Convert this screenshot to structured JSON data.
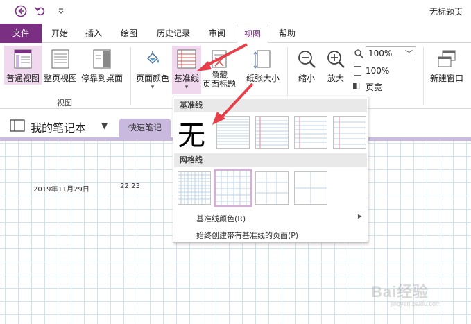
{
  "window": {
    "title": "无标题页"
  },
  "tabs": [
    {
      "label": "文件"
    },
    {
      "label": "开始"
    },
    {
      "label": "插入"
    },
    {
      "label": "绘图"
    },
    {
      "label": "历史记录"
    },
    {
      "label": "审阅"
    },
    {
      "label": "视图"
    },
    {
      "label": "帮助"
    }
  ],
  "ribbon": {
    "views_group": {
      "normal_view": "普通视图",
      "full_page_view": "整页视图",
      "dock_to_desktop": "停靠到桌面",
      "group_label": "视图"
    },
    "page_setup": {
      "page_color": "页面颜色",
      "rule_lines": "基准线",
      "hide_title": "隐藏\n页面标题",
      "paper_size": "纸张大小"
    },
    "zoom": {
      "zoom_out": "缩小",
      "zoom_in": "放大",
      "zoom_value": "100%",
      "percent_100": "100%",
      "page_width": "页宽"
    },
    "window": {
      "new_window": "新建窗口"
    }
  },
  "notebook": {
    "name": "我的笔记本",
    "section": "快速笔记"
  },
  "page": {
    "date": "2019年11月29日",
    "time": "22:23"
  },
  "dropdown": {
    "rule_lines_header": "基准线",
    "none_label": "无",
    "grid_lines_header": "网格线",
    "rule_line_color": "基准线颜色(R)",
    "always_create": "始终创建带有基准线的页面(P)"
  },
  "colors": {
    "accent": "#7a2f82",
    "selected_bg": "#f0d9ef",
    "section_tab": "#c9b9df",
    "grid": "#cfe4ef",
    "arrow": "#e8404a"
  },
  "watermark": {
    "brand": "Bai经验",
    "site": "jingyan.baidu.com"
  }
}
